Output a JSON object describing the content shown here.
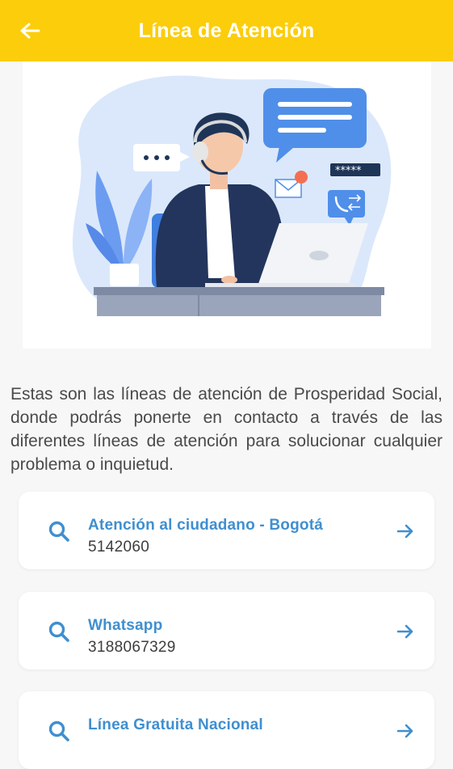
{
  "header": {
    "title": "Línea de Atención",
    "back_icon": "arrow-left-icon",
    "background_color": "#fccd0b"
  },
  "hero": {
    "icon": "customer-service-illustration"
  },
  "intro": {
    "text": "Estas son las líneas de atención de Prosperidad Social, donde podrás ponerte en contacto a través de las diferentes líneas de atención para solucionar cualquier problema o inquietud."
  },
  "lines": [
    {
      "title": "Atención al ciudadano - Bogotá",
      "phone": "5142060",
      "icon": "search-icon",
      "action_icon": "arrow-right-icon"
    },
    {
      "title": "Whatsapp",
      "phone": "3188067329",
      "icon": "search-icon",
      "action_icon": "arrow-right-icon"
    },
    {
      "title": "Línea Gratuita Nacional",
      "phone": "",
      "icon": "search-icon",
      "action_icon": "arrow-right-icon"
    }
  ],
  "colors": {
    "accent": "#3f8fd0",
    "text": "#4a4a4a",
    "background": "#f7f7f7"
  }
}
